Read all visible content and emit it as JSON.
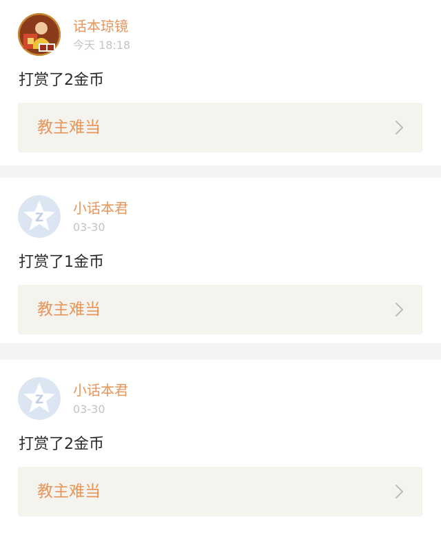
{
  "feed": {
    "items": [
      {
        "username": "话本琼镜",
        "time": "今天 18:18",
        "message": "打赏了2金币",
        "book_title": "教主难当",
        "avatar_icon": "custom-profile-photo"
      },
      {
        "username": "小话本君",
        "time": "03-30",
        "message": "打赏了1金币",
        "book_title": "教主难当",
        "avatar_icon": "default-z-star-avatar"
      },
      {
        "username": "小话本君",
        "time": "03-30",
        "message": "打赏了2金币",
        "book_title": "教主难当",
        "avatar_icon": "default-z-star-avatar"
      }
    ]
  },
  "colors": {
    "accent": "#e8955a",
    "page_background": "#f4f4f4",
    "link_card_background": "#f5f3ee",
    "timestamp": "#c4c4c4",
    "text": "#2b2b2b"
  }
}
